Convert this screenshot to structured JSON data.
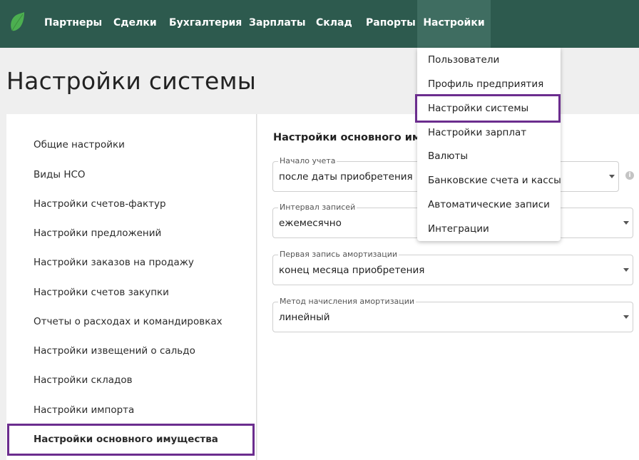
{
  "nav": {
    "items": [
      "Партнеры",
      "Сделки",
      "Бухгалтерия",
      "Зарплаты",
      "Склад",
      "Рапорты",
      "Настройки"
    ],
    "active": "Настройки"
  },
  "page": {
    "title": "Настройки системы"
  },
  "sidebar": {
    "items": [
      "Общие настройки",
      "Виды НСО",
      "Настройки счетов-фактур",
      "Настройки предложений",
      "Настройки заказов на продажу",
      "Настройки счетов закупки",
      "Отчеты о расходах и командировках",
      "Настройки извещений о сальдо",
      "Настройки складов",
      "Настройки импорта",
      "Настройки основного имущества"
    ],
    "active": "Настройки основного имущества"
  },
  "section": {
    "title": "Настройки основного имущества",
    "fields": [
      {
        "label": "Начало учета",
        "value": "после даты приобретения"
      },
      {
        "label": "Интервал записей",
        "value": "ежемесячно"
      },
      {
        "label": "Первая запись амортизации",
        "value": "конец месяца приобретения"
      },
      {
        "label": "Метод начисления амортизации",
        "value": "линейный"
      }
    ]
  },
  "dropdown": {
    "items": [
      "Пользователи",
      "Профиль предприятия",
      "Настройки системы",
      "Настройки зарплат",
      "Валюты",
      "Банковские счета и кассы",
      "Автоматические записи",
      "Интеграции"
    ],
    "highlighted": "Настройки системы"
  },
  "colors": {
    "topbar": "#2d5a4e",
    "active_nav": "#3f6d61",
    "highlight_border": "#6b2d8e",
    "logo": "#4caf50"
  },
  "icons": {
    "logo": "leaf-logo-icon",
    "info": "info-icon",
    "dropdown_arrow": "chevron-down-icon"
  }
}
